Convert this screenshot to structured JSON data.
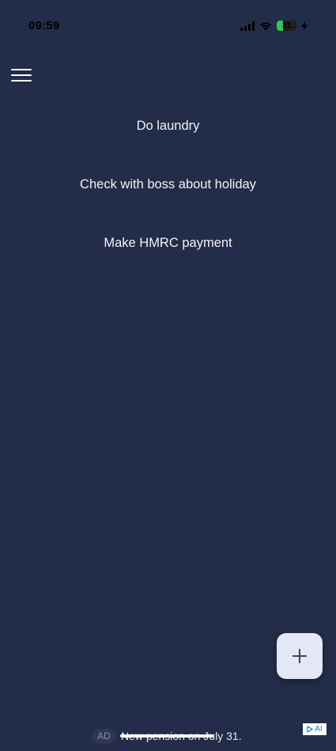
{
  "status_bar": {
    "time": "09:59",
    "battery_level": "31",
    "battery_percent": 31,
    "icons": [
      "signal-icon",
      "wifi-icon",
      "battery-icon",
      "charging-bolt-icon"
    ]
  },
  "header": {
    "menu_icon": "hamburger-menu-icon"
  },
  "tasks": [
    {
      "label": "Do laundry"
    },
    {
      "label": "Check with boss about holiday"
    },
    {
      "label": "Make HMRC payment"
    }
  ],
  "fab": {
    "icon": "plus-icon"
  },
  "ad": {
    "badge": "AD",
    "text": "New pension on July 31.",
    "adchoices_label": "AI"
  },
  "colors": {
    "background": "#232c48",
    "fab_background": "#e3e7f6",
    "battery_fill": "#34c759"
  }
}
